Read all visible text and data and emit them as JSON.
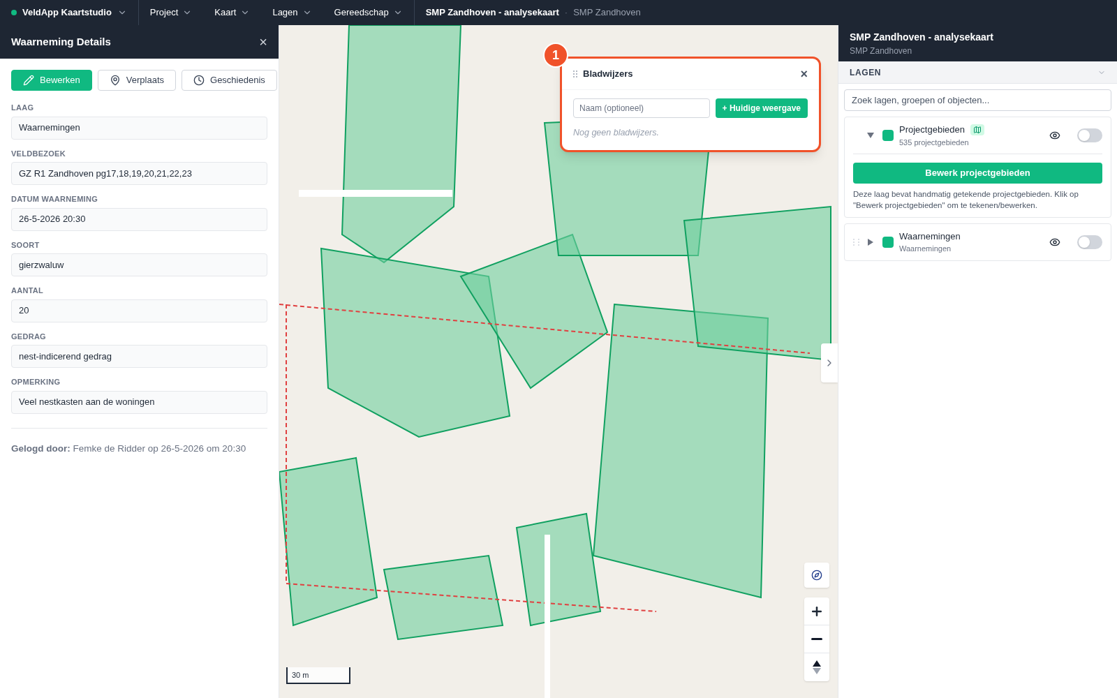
{
  "menu_bar": {
    "app": "VeldApp Kaartstudio",
    "menus": [
      "Project",
      "Kaart",
      "Lagen",
      "Gereedschap"
    ],
    "title": "SMP Zandhoven - analysekaart",
    "separator": "·",
    "subtitle": "SMP Zandhoven"
  },
  "details_panel": {
    "title": "Waarneming Details",
    "close": "×",
    "actions": [
      {
        "kind": "edit",
        "label": "Bewerken",
        "selected": true
      },
      {
        "kind": "move",
        "label": "Verplaats",
        "selected": false
      },
      {
        "kind": "history",
        "label": "Geschiedenis",
        "selected": false
      }
    ],
    "fields": [
      {
        "label": "LAAG",
        "value": "Waarnemingen"
      },
      {
        "label": "VELDBEZOEK",
        "value": "GZ R1 Zandhoven pg17,18,19,20,21,22,23"
      },
      {
        "label": "DATUM WAARNEMING",
        "value": "26-5-2026 20:30"
      },
      {
        "label": "SOORT",
        "value": "gierzwaluw"
      },
      {
        "label": "AANTAL",
        "value": "20"
      },
      {
        "label": "GEDRAG",
        "value": "nest-indicerend gedrag"
      },
      {
        "label": "OPMERKING",
        "value": "Veel nestkasten aan de woningen"
      }
    ],
    "logged_by": "**Gelogd door:** Femke de Ridder op 26-5-2026 om 20:30"
  },
  "map": {
    "kind": "picture",
    "scale": "30 m",
    "step_badge": "1",
    "bookmarks": {
      "title": "Bladwijzers",
      "close": "×",
      "placeholder": "Naam (optioneel)",
      "add_button": "+ Huidige weergave",
      "empty": "Nog geen bladwijzers."
    }
  },
  "layers_panel": {
    "title": "SMP Zandhoven - analysekaart",
    "subtitle": "SMP Zandhoven",
    "section": "LAGEN",
    "search_placeholder": "Zoek lagen, groepen of objecten...",
    "layers": [
      {
        "name": "Projectgebieden",
        "meta": "535 projectgebieden",
        "expanded": true,
        "on": false,
        "edit_button": "Bewerk projectgebieden",
        "note": "Deze laag bevat handmatig getekende projectgebieden. Klik op \"Bewerk projectgebieden\" om te tekenen/bewerken."
      },
      {
        "name": "Waarnemingen",
        "meta": "Waarnemingen",
        "expanded": false,
        "on": false
      }
    ]
  }
}
